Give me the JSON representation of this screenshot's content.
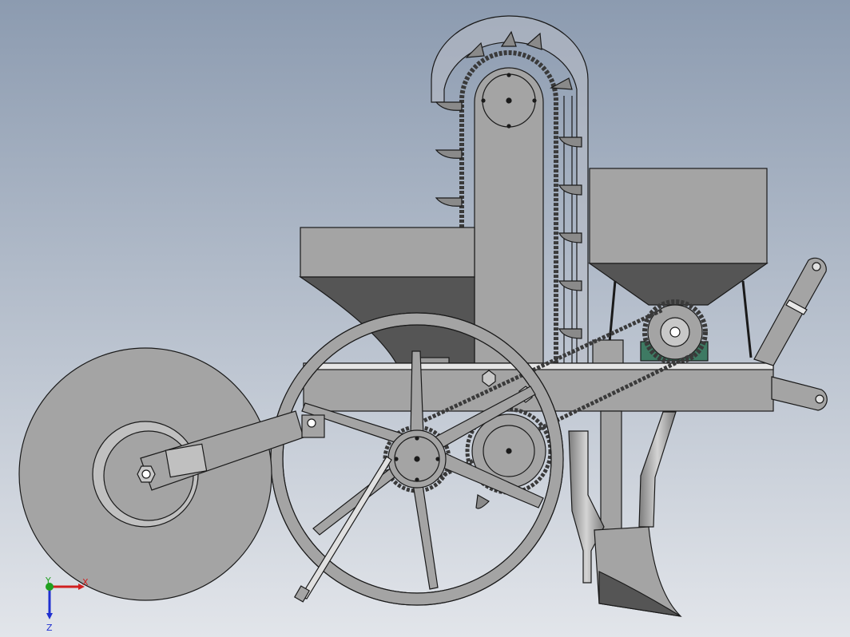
{
  "viewport": {
    "background_top": "#8c9bb0",
    "background_bottom": "#e2e5ea"
  },
  "colors": {
    "metal": "#a4a4a4",
    "metal_dark": "#505050",
    "metal_light": "#c8c8c8",
    "outline": "#1a1a1a",
    "chain": "#3a3a3a",
    "green_mount": "#3e7a63",
    "axis_x": "#d02020",
    "axis_y": "#20a020",
    "axis_z": "#2030d0"
  },
  "triad": {
    "x_label": "X",
    "y_label": "Y",
    "z_label": "Z"
  },
  "icons": {
    "triad": "coordinate-axes-icon"
  }
}
